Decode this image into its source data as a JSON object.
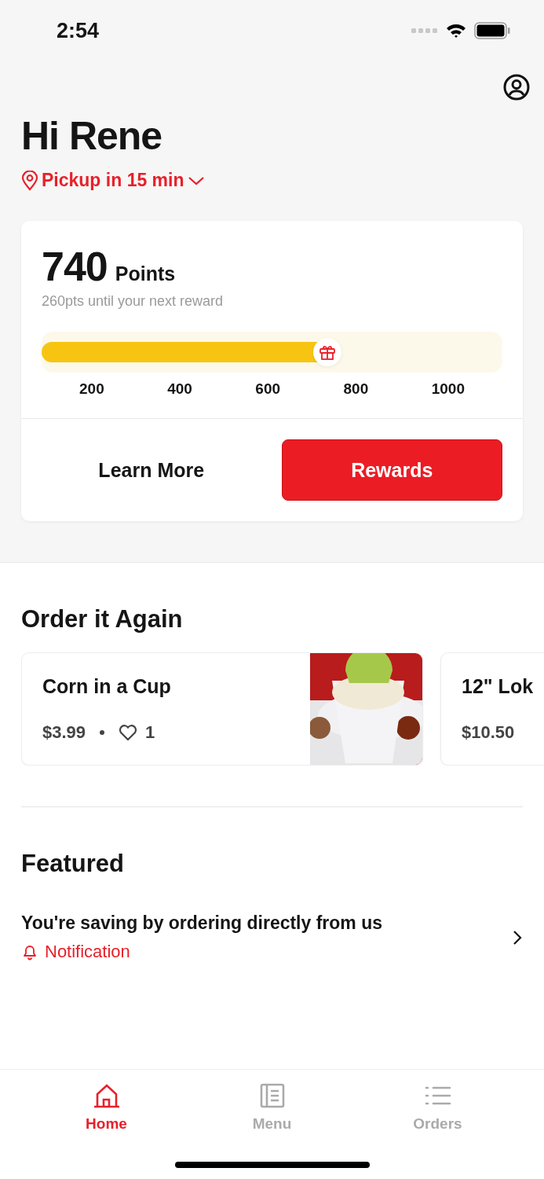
{
  "status_bar": {
    "time": "2:54"
  },
  "greeting": "Hi Rene",
  "pickup": "Pickup in 15 min",
  "rewards_card": {
    "points": "740",
    "points_label": "Points",
    "subtitle": "260pts until your next reward",
    "level": 0.62,
    "ticks": [
      "200",
      "400",
      "600",
      "800",
      "1000"
    ],
    "buttons": [
      {
        "label": "Learn More",
        "kind": "plain"
      },
      {
        "label": "Rewards",
        "kind": "primary"
      }
    ]
  },
  "order_again": {
    "title": "Order it Again",
    "items": [
      {
        "name": "Corn in a Cup",
        "price": "$3.99",
        "likes": "1",
        "kind": "picture"
      },
      {
        "name": "12\" Lok",
        "price": "$10.50"
      }
    ]
  },
  "featured": {
    "title": "Featured",
    "items": [
      {
        "title": "You're saving by ordering directly from us",
        "tag": "Notification"
      }
    ]
  },
  "tab_bar": [
    {
      "label": "Home",
      "selected": true,
      "kind": "home"
    },
    {
      "label": "Menu",
      "selected": false,
      "kind": "menu"
    },
    {
      "label": "Orders",
      "selected": false,
      "kind": "orders"
    }
  ]
}
